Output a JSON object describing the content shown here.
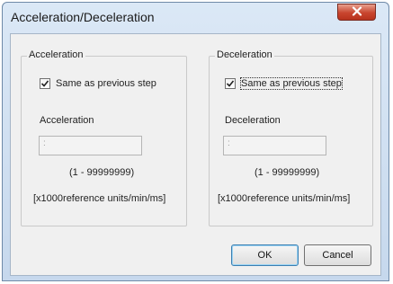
{
  "window": {
    "title": "Acceleration/Deceleration"
  },
  "icons": {
    "close": "close-x-icon",
    "check": "checkmark-icon"
  },
  "colors": {
    "close_button": "#c8452e",
    "title_bar": "#dbe8f6",
    "client_bg": "#f0f0f0"
  },
  "acceleration": {
    "group_label": "Acceleration",
    "checkbox_label": "Same as previous step",
    "checked": true,
    "field_label": "Acceleration",
    "value": ":",
    "range": "(1 - 99999999)",
    "units": "[x1000reference units/min/ms]"
  },
  "deceleration": {
    "group_label": "Deceleration",
    "checkbox_label": "Same as previous step",
    "checked": true,
    "field_label": "Deceleration",
    "value": ":",
    "range": "(1 - 99999999)",
    "units": "[x1000reference units/min/ms]"
  },
  "buttons": {
    "ok": "OK",
    "cancel": "Cancel"
  }
}
